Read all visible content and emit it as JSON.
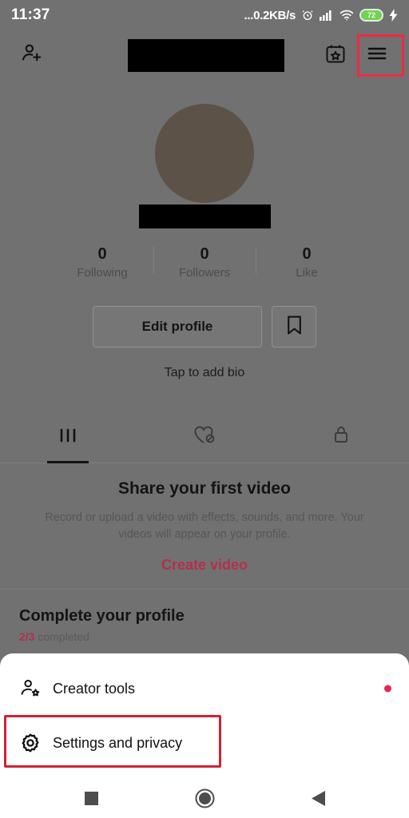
{
  "status_bar": {
    "time": "11:37",
    "network_speed": "...0.2KB/s",
    "alarm_icon": "alarm-clock-icon",
    "signal_icon": "cellular-signal-icon",
    "wifi_icon": "wifi-icon",
    "battery_level": "72",
    "charging_icon": "charging-bolt-icon"
  },
  "header": {
    "add_friend_icon": "add-person-icon",
    "username": "",
    "username_redacted": true,
    "calendar_icon": "calendar-star-icon",
    "menu_icon": "hamburger-menu-icon",
    "menu_highlight_color": "#ee2b41"
  },
  "profile": {
    "avatar_label": "profile-avatar",
    "avatar_color": "#5c5247",
    "handle": "",
    "handle_redacted": true,
    "stats": [
      {
        "count": "0",
        "label": "Following"
      },
      {
        "count": "0",
        "label": "Followers"
      },
      {
        "count": "0",
        "label": "Like"
      }
    ],
    "edit_profile_label": "Edit profile",
    "bookmark_icon": "bookmark-icon",
    "bio_placeholder": "Tap to add bio"
  },
  "tabs": [
    {
      "icon": "grid-videos-icon",
      "active": true
    },
    {
      "icon": "heart-slash-liked-icon",
      "active": false
    },
    {
      "icon": "lock-private-icon",
      "active": false
    }
  ],
  "empty_state": {
    "title": "Share your first video",
    "description": "Record or upload a video with effects, sounds, and more. Your videos will appear on your profile.",
    "action_label": "Create video",
    "action_color": "#b3304a"
  },
  "complete_profile": {
    "title": "Complete your profile",
    "fraction": "2/3",
    "fraction_suffix": " completed",
    "accent_color": "#b3304a"
  },
  "bottom_sheet": {
    "items": [
      {
        "icon": "creator-tools-person-star-icon",
        "label": "Creator tools",
        "badge": "red-dot",
        "badge_color": "#e8264f"
      },
      {
        "icon": "settings-gear-icon",
        "label": "Settings and privacy",
        "badge": "",
        "highlight_color": "#cf2233"
      }
    ]
  },
  "nav_bar": {
    "recents_icon": "square-recents-icon",
    "home_icon": "circle-home-icon",
    "back_icon": "triangle-back-icon"
  }
}
